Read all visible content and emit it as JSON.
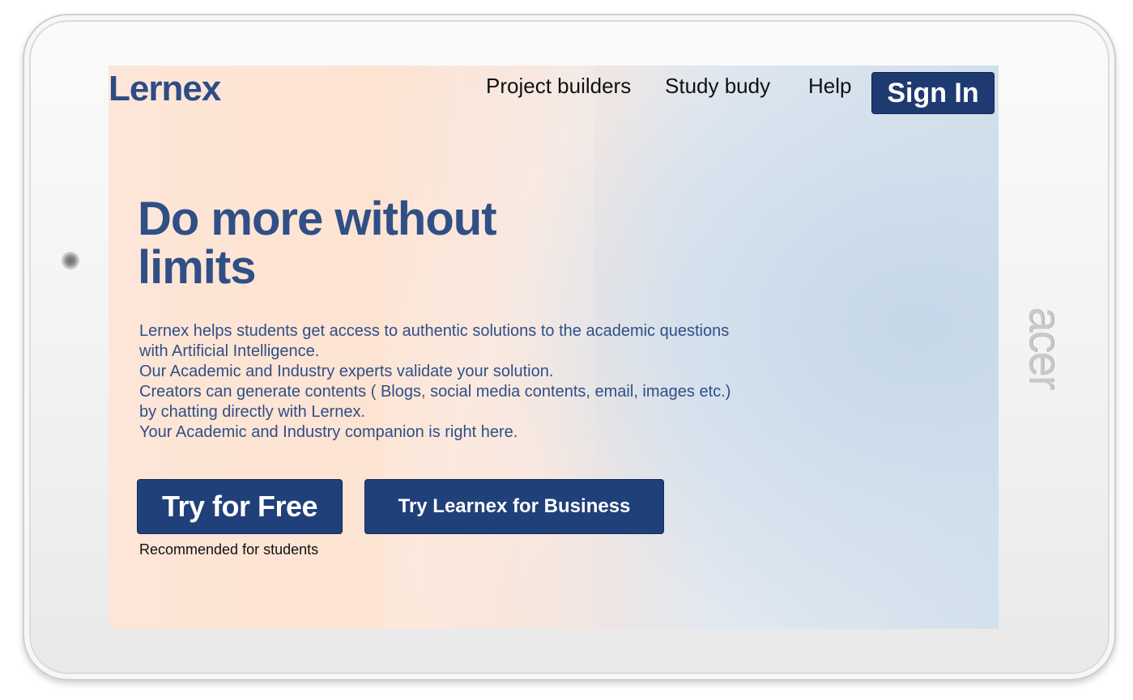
{
  "device": {
    "brand": "acer"
  },
  "header": {
    "logo": "Lernex",
    "nav": [
      {
        "label": "Project builders"
      },
      {
        "label": "Study budy"
      },
      {
        "label": "Help"
      }
    ],
    "sign_in_label": "Sign In"
  },
  "hero": {
    "headline_line1": "Do more without",
    "headline_line2": "limits",
    "description_lines": [
      "Lernex helps students get access to authentic solutions to the academic questions",
      "with Artificial Intelligence.",
      "Our Academic and Industry experts validate your solution.",
      "Creators can generate contents ( Blogs, social media contents, email, images etc.)",
      "by chatting directly with Lernex.",
      "Your Academic and Industry companion is right here."
    ],
    "cta_free_label": "Try for Free",
    "cta_business_label": "Try Learnex for Business",
    "recommend_text": "Recommended for students"
  },
  "colors": {
    "primary": "#1e3a70",
    "headline": "#2f4f86",
    "gradient_warm": "#fde3d2",
    "gradient_cool": "#d3e1ec"
  }
}
